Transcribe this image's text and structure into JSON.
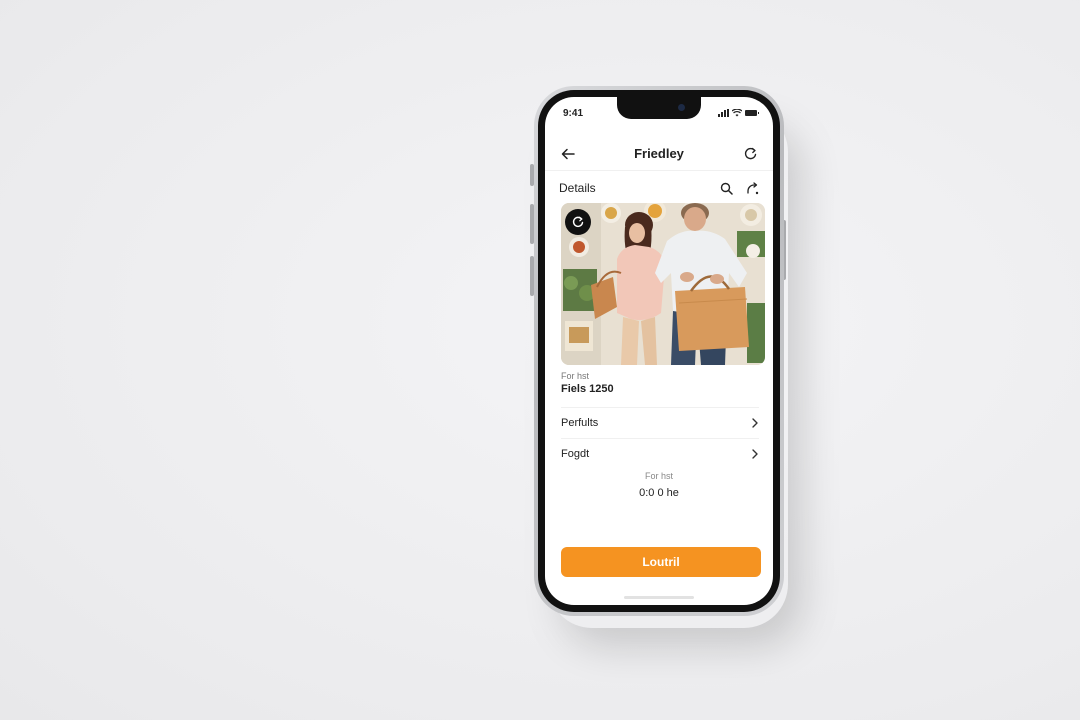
{
  "status_bar": {
    "time": "9:41"
  },
  "nav": {
    "title": "Friedley",
    "back_icon": "arrow-left-icon",
    "action_icon": "refresh-icon"
  },
  "section": {
    "title": "Details",
    "icons": [
      "search-icon",
      "share-icon"
    ]
  },
  "hero": {
    "alt": "",
    "badge_icon": "circle-arrow-icon"
  },
  "info": {
    "label": "For hst",
    "value": "Fiels 1250"
  },
  "rows": [
    {
      "label": "Perfults"
    },
    {
      "label": "Fogdt"
    }
  ],
  "summary": {
    "label": "For hst",
    "value": "0:0 0 he"
  },
  "cta": {
    "label": "Loutril"
  },
  "colors": {
    "accent": "#f59321",
    "background": "#eeeff1",
    "text": "#222222"
  }
}
